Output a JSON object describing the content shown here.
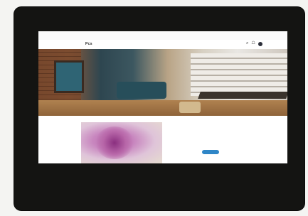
{
  "topbar": {
    "announcement": ""
  },
  "header": {
    "logo": "Pcs",
    "nav": [
      "",
      "",
      "",
      "",
      "",
      "",
      ""
    ],
    "icons": [
      "search-icon",
      "cart-icon",
      "avatar"
    ]
  },
  "hero": {
    "caption": ""
  },
  "promo": {
    "title": "",
    "button_label": ""
  },
  "colors": {
    "accent": "#2f86c7",
    "bezel": "#141412"
  }
}
